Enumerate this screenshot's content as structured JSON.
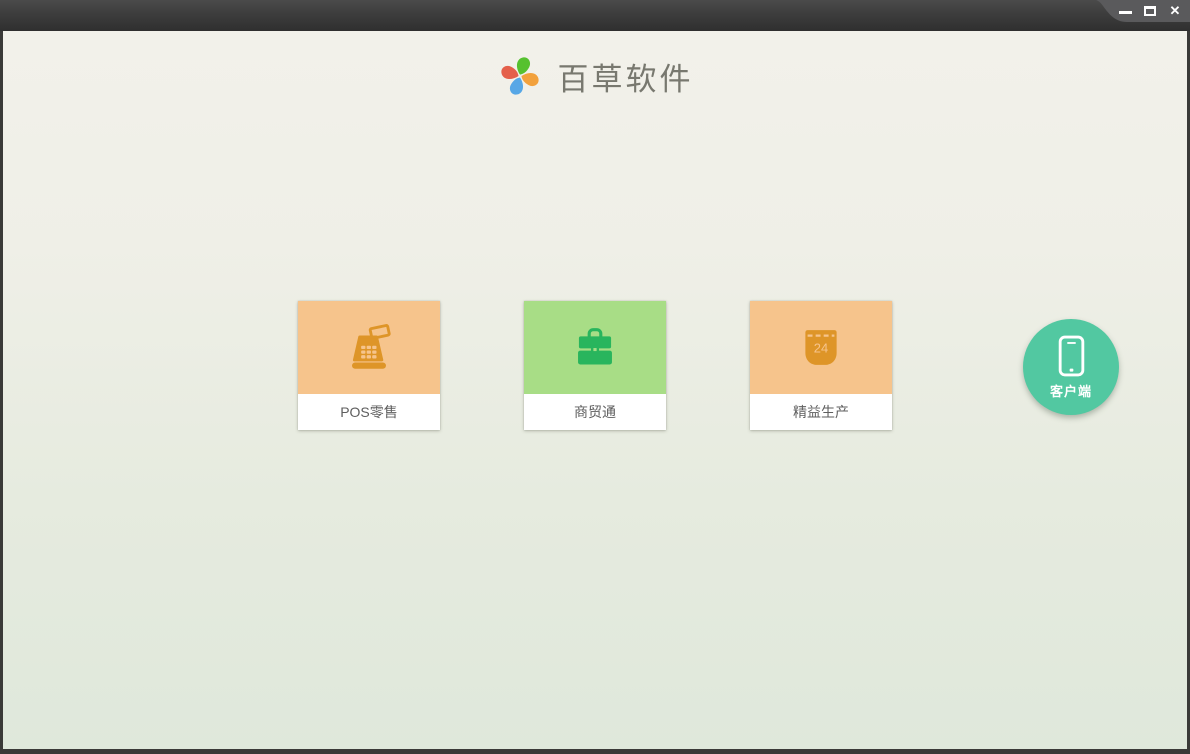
{
  "window": {
    "titlebar_color": "#3a3a3a",
    "frame_color": "#3a3a38",
    "controls": {
      "minimize_icon": "minimize",
      "maximize_icon": "maximize",
      "close_icon": "close",
      "close_glyph": "✕"
    }
  },
  "header": {
    "app_title": "百草软件",
    "logo": {
      "icon": "pinwheel-logo",
      "colors": {
        "green": "#56c12f",
        "orange": "#f2a13c",
        "blue": "#57a7e6",
        "red": "#e4604b"
      }
    }
  },
  "background": {
    "top": "#f2f1ea",
    "bottom": "#dfe8db"
  },
  "products": [
    {
      "label": "POS零售",
      "icon": "cash-register-icon",
      "tile_bg": "#f6c48c",
      "icon_color": "#de9528"
    },
    {
      "label": "商贸通",
      "icon": "briefcase-icon",
      "tile_bg": "#a8dd86",
      "icon_color": "#29b55d"
    },
    {
      "label": "精益生产",
      "icon": "calendar-icon",
      "tile_bg": "#f6c48c",
      "icon_color": "#de9528",
      "calendar_day": "24"
    }
  ],
  "client_button": {
    "label": "客户端",
    "icon": "smartphone-icon",
    "bg": "#52c8a1"
  }
}
